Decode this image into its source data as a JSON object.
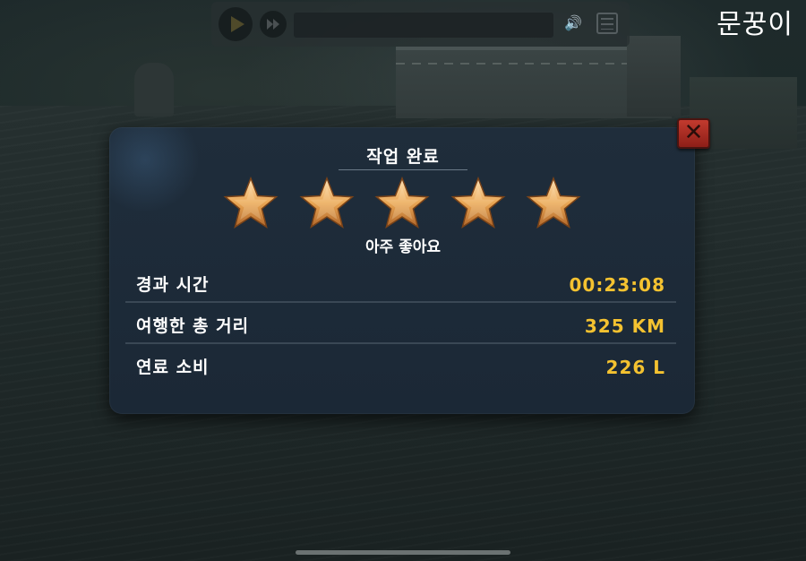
{
  "brand": {
    "name": "문꿍이"
  },
  "video_controls": {
    "play_icon": "play-icon",
    "fast_forward_icon": "fast-forward-icon",
    "volume_icon": "volume-icon",
    "menu_icon": "list-icon"
  },
  "dialog": {
    "title": "작업 완료",
    "stars": {
      "earned": 5,
      "total": 5
    },
    "rating_text": "아주 좋아요",
    "close_icon": "close-icon",
    "stats": [
      {
        "label": "경과 시간",
        "value": "00:23:08"
      },
      {
        "label": "여행한 총 거리",
        "value": "325 KM"
      },
      {
        "label": "연료 소비",
        "value": "226 L"
      }
    ]
  },
  "colors": {
    "panel_bg": "#1d2a38",
    "value_accent": "#f4c230",
    "close_button": "#b3322a",
    "star_gold": "#e9a654"
  }
}
